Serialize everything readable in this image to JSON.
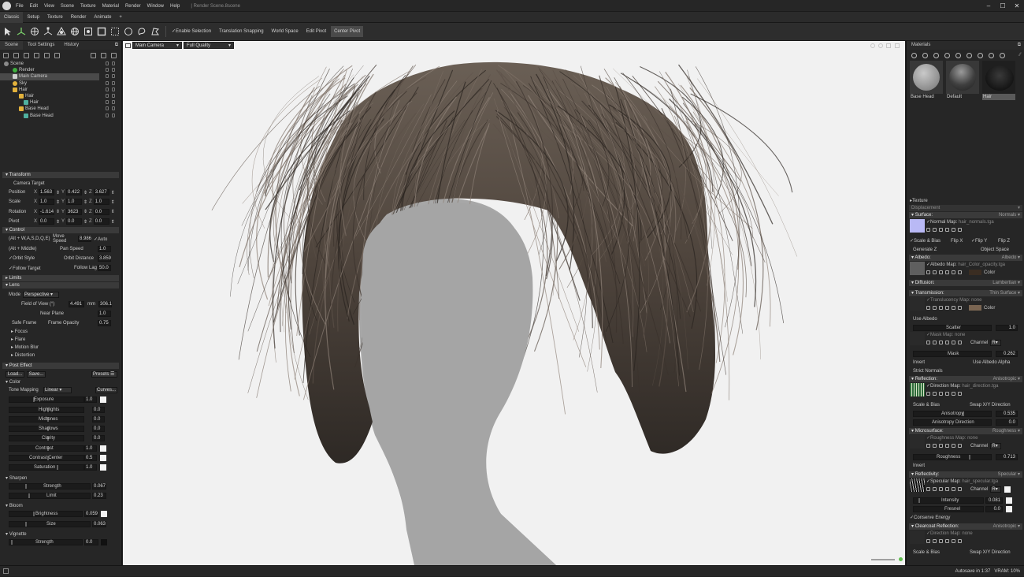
{
  "titlebar": {
    "menus": [
      "File",
      "Edit",
      "View",
      "Scene",
      "Texture",
      "Material",
      "Render",
      "Window",
      "Help"
    ],
    "document": "Render Scene.8scene"
  },
  "tabs": [
    "Classic",
    "Setup",
    "Texture",
    "Render",
    "Animate",
    "+"
  ],
  "toolbar": {
    "toggles": [
      "Enable Selection",
      "Translation Snapping",
      "World Space",
      "Edit Pivot",
      "Center Pivot"
    ]
  },
  "left_tabs": [
    "Scene",
    "Tool Settings",
    "History"
  ],
  "tree": [
    {
      "label": "Scene",
      "depth": 0,
      "color": "#8a8a8a"
    },
    {
      "label": "Render",
      "depth": 1,
      "color": "#3fae3f"
    },
    {
      "label": "Main Camera",
      "depth": 1,
      "color": "#cfcfcf",
      "selected": true
    },
    {
      "label": "Sky",
      "depth": 1,
      "color": "#e3b23c"
    },
    {
      "label": "Hair",
      "depth": 1,
      "color": "#e3b23c"
    },
    {
      "label": "Hair",
      "depth": 2,
      "color": "#e3b23c"
    },
    {
      "label": "Hair",
      "depth": 3,
      "color": "#4fb0a0"
    },
    {
      "label": "Base Head",
      "depth": 2,
      "color": "#e3b23c"
    },
    {
      "label": "Base Head",
      "depth": 3,
      "color": "#4fb0a0"
    }
  ],
  "transform": {
    "header": "Transform",
    "camera_target": "Camera Target",
    "position": {
      "label": "Position",
      "x": "1.563",
      "y": "0.422",
      "z": "3.627"
    },
    "scale": {
      "label": "Scale",
      "x": "1.0",
      "y": "1.0",
      "z": "1.0"
    },
    "rotation": {
      "label": "Rotation",
      "x": "-1.614",
      "y": "3623",
      "z": "0.0"
    },
    "pivot": {
      "label": "Pivot",
      "x": "0.0",
      "y": "0.0",
      "z": "0.0"
    }
  },
  "control": {
    "header": "Control",
    "keys": "(Alt + W,A,S,D,Q,E)",
    "move_speed_label": "Move Speed",
    "move_speed": "8.986",
    "auto": "Auto",
    "alt_middle": "(Alt + Middle)",
    "pan_speed_label": "Pan Speed",
    "pan_speed": "1.0",
    "orbit_style": "Orbit Style",
    "orbit_distance_label": "Orbit Distance",
    "orbit_distance": "3.859",
    "follow_target": "Follow Target",
    "follow_lag_label": "Follow Lag",
    "follow_lag": "50.0"
  },
  "limits": "Limits",
  "lens": {
    "header": "Lens",
    "mode_label": "Mode",
    "mode": "Perspective",
    "fov_label": "Field of View (°)",
    "fov": "4.491",
    "mm_label": "mm",
    "mm": "306.1",
    "near_plane_label": "Near Plane",
    "near_plane": "1.0",
    "safe_frame": "Safe Frame",
    "frame_opacity_label": "Frame Opacity",
    "frame_opacity": "0.75",
    "sub": [
      "Focus",
      "Flare",
      "Motion Blur",
      "Distortion"
    ]
  },
  "post": {
    "header": "Post Effect",
    "load": "Load...",
    "save": "Save...",
    "presets": "Presets",
    "color_header": "Color",
    "tone_label": "Tone Mapping",
    "tone": "Linear",
    "curves": "Curves...",
    "exposure": {
      "label": "Exposure",
      "value": "1.0"
    },
    "highlights": {
      "label": "Highlights",
      "value": "0.0"
    },
    "midtones": {
      "label": "Midtones",
      "value": "0.0"
    },
    "shadows": {
      "label": "Shadows",
      "value": "0.0"
    },
    "clarity": {
      "label": "Clarity",
      "value": "0.0"
    },
    "contrast": {
      "label": "Contrast",
      "value": "1.0"
    },
    "contrast_center": {
      "label": "Contrast Center",
      "value": "0.5"
    },
    "saturation": {
      "label": "Saturation",
      "value": "1.0"
    },
    "sharpen_header": "Sharpen",
    "sharpen_strength": {
      "label": "Strength",
      "value": "0.067"
    },
    "sharpen_limit": {
      "label": "Limit",
      "value": "0.23"
    },
    "bloom_header": "Bloom",
    "bloom_brightness": {
      "label": "Brightness",
      "value": "0.059"
    },
    "bloom_size": {
      "label": "Size",
      "value": "0.063"
    },
    "vignette_header": "Vignette",
    "vignette_strength": {
      "label": "Strength",
      "value": "0.0"
    }
  },
  "viewport": {
    "camera": "Main Camera",
    "quality": "Full Quality"
  },
  "materials": {
    "header": "Materials",
    "items": [
      {
        "label": "Base Head"
      },
      {
        "label": "Default"
      },
      {
        "label": "Hair",
        "selected": true
      }
    ],
    "texture": "Texture",
    "displacement": "Displacement",
    "surface": {
      "label": "Surface:",
      "value": "Normals"
    },
    "normal_map": {
      "label": "Normal Map:",
      "value": "hair_normals.tga"
    },
    "scale_bias": "Scale & Bias",
    "flip_x": "Flip X",
    "flip_y": "Flip Y",
    "flip_z": "Flip Z",
    "generate_z": "Generate Z",
    "object_space": "Object Space",
    "albedo": {
      "label": "Albedo:",
      "value": "Albedo"
    },
    "albedo_map": {
      "label": "Albedo Map:",
      "value": "hair_Color_opacity.tga"
    },
    "color": "Color",
    "diffusion": {
      "label": "Diffusion:",
      "value": "Lambertian"
    },
    "transmission": {
      "label": "Transmission:",
      "value": "Thin Surface"
    },
    "translucency_map": {
      "label": "Translucency Map:",
      "value": "none"
    },
    "use_albedo": "Use Albedo",
    "scatter": {
      "label": "Scatter",
      "value": "1.0"
    },
    "mask_map": {
      "label": "Mask Map:",
      "value": "none"
    },
    "channel": "Channel",
    "channel_value": "R",
    "mask": {
      "label": "Mask",
      "value": "0.262"
    },
    "invert": "Invert",
    "use_albedo_alpha": "Use Albedo Alpha",
    "strict_normals": "Strict Normals",
    "reflection": {
      "label": "Reflection:",
      "value": "Anisotropic"
    },
    "direction_map": {
      "label": "Direction Map:",
      "value": "hair_direction.tga"
    },
    "swap_xy": "Swap X/Y Direction",
    "anisotropy": {
      "label": "Anisotropy",
      "value": "0.535"
    },
    "anisotropy_direction": {
      "label": "Anisotropy Direction",
      "value": "0.0"
    },
    "microsurface": {
      "label": "Microsurface:",
      "value": "Roughness"
    },
    "roughness_map": {
      "label": "Roughness Map:",
      "value": "none"
    },
    "roughness": {
      "label": "Roughness",
      "value": "0.713"
    },
    "reflectivity": {
      "label": "Reflectivity:",
      "value": "Specular"
    },
    "specular_map": {
      "label": "Specular Map:",
      "value": "hair_specular.tga"
    },
    "intensity": {
      "label": "Intensity",
      "value": "0.081"
    },
    "fresnel": {
      "label": "Fresnel",
      "value": "0.0"
    },
    "conserve_energy": "Conserve Energy",
    "clearcoat": {
      "label": "Clearcoat Reflection:",
      "value": "Anisotropic"
    },
    "cc_direction_map": {
      "label": "Direction Map:",
      "value": "none"
    }
  },
  "status": {
    "autosave": "Autosave in 1:37",
    "vram": "VRAM: 10%"
  }
}
